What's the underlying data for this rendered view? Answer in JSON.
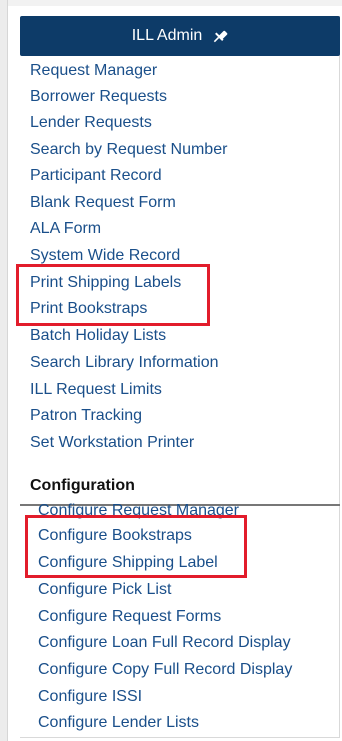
{
  "panel": {
    "title": "ILL Admin",
    "pin_icon": "pin-icon"
  },
  "admin_items": [
    "Request Manager",
    "Borrower Requests",
    "Lender Requests",
    "Search by Request Number",
    "Participant Record",
    "Blank Request Form",
    "ALA Form",
    "System Wide Record",
    "Print Shipping Labels",
    "Print Bookstraps",
    "Batch Holiday Lists",
    "Search Library Information",
    "ILL Request Limits",
    "Patron Tracking",
    "Set Workstation Printer"
  ],
  "configuration": {
    "heading": "Configuration",
    "items": [
      "Configure Request Manager",
      "Configure Bookstraps",
      "Configure Shipping Label",
      "Configure Pick List",
      "Configure Request Forms",
      "Configure Loan Full Record Display",
      "Configure Copy Full Record Display",
      "Configure ISSI",
      "Configure Lender Lists"
    ]
  },
  "colors": {
    "header_bg": "#0d3b68",
    "link": "#1a4f8a",
    "highlight_box": "#e21c2b"
  }
}
